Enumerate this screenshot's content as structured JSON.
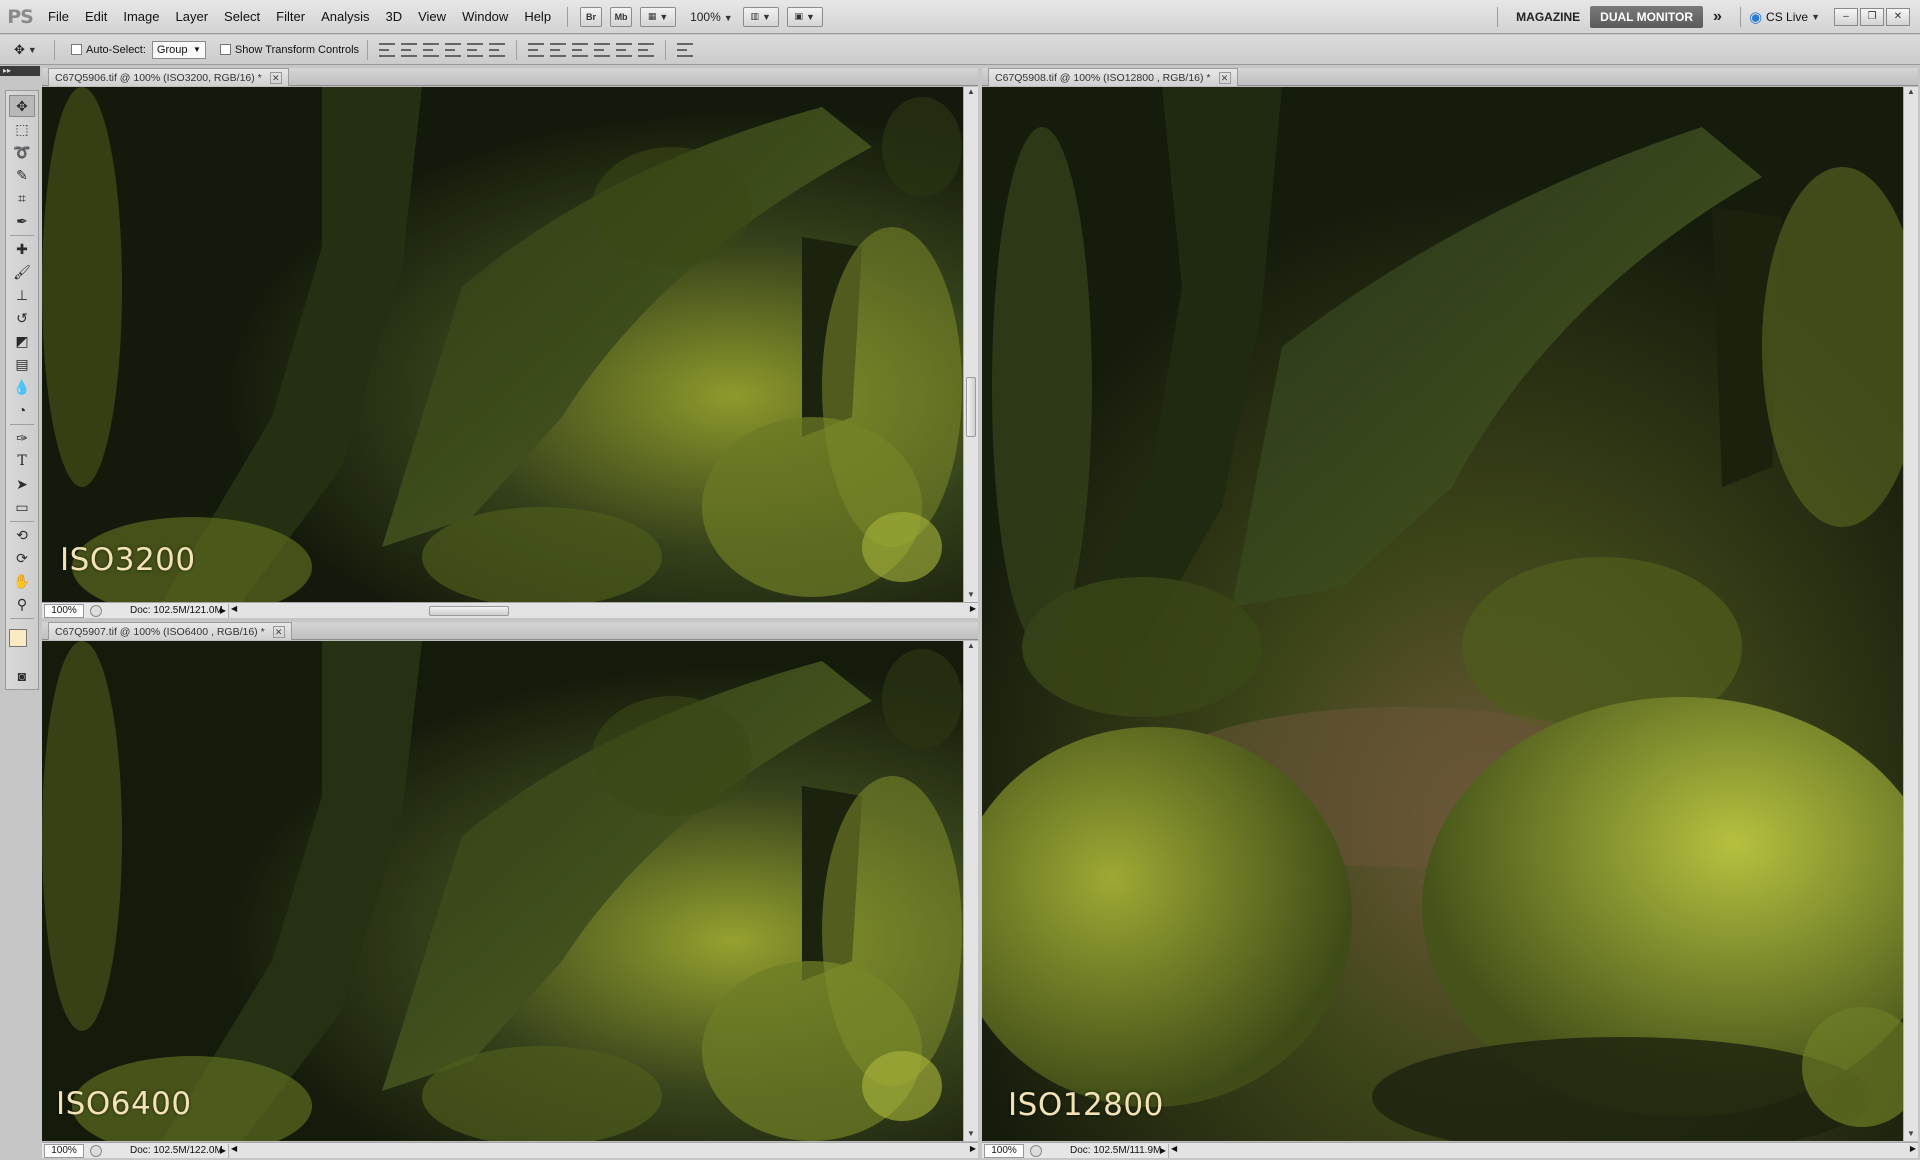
{
  "app": {
    "logo": "PS"
  },
  "menu": [
    "File",
    "Edit",
    "Image",
    "Layer",
    "Select",
    "Filter",
    "Analysis",
    "3D",
    "View",
    "Window",
    "Help"
  ],
  "menubar": {
    "bridge_label": "Br",
    "minibridge_label": "Mb",
    "zoom_value": "100%",
    "workspace_magazine": "MAGAZINE",
    "workspace_active": "DUAL MONITOR",
    "more_label": "»",
    "cslive_label": "CS Live"
  },
  "options": {
    "auto_select_label": "Auto-Select:",
    "auto_select_value": "Group",
    "transform_label": "Show Transform Controls"
  },
  "documents": [
    {
      "title": "C67Q5906.tif @ 100% (ISO3200, RGB/16) *",
      "iso": "ISO3200",
      "zoom": "100%",
      "doc_info": "Doc: 102.5M/121.0M"
    },
    {
      "title": "C67Q5907.tif @ 100% (ISO6400 , RGB/16) *",
      "iso": "ISO6400",
      "zoom": "100%",
      "doc_info": "Doc: 102.5M/122.0M"
    },
    {
      "title": "C67Q5908.tif @ 100% (ISO12800 , RGB/16) *",
      "iso": "ISO12800",
      "zoom": "100%",
      "doc_info": "Doc: 102.5M/111.9M"
    }
  ],
  "colors": {
    "foreground": "#fbeac4",
    "background": "#ffffff",
    "iso_text": "#f2e2b6",
    "moss_dark": "#1b2410",
    "moss_light": "#a7b43a"
  }
}
